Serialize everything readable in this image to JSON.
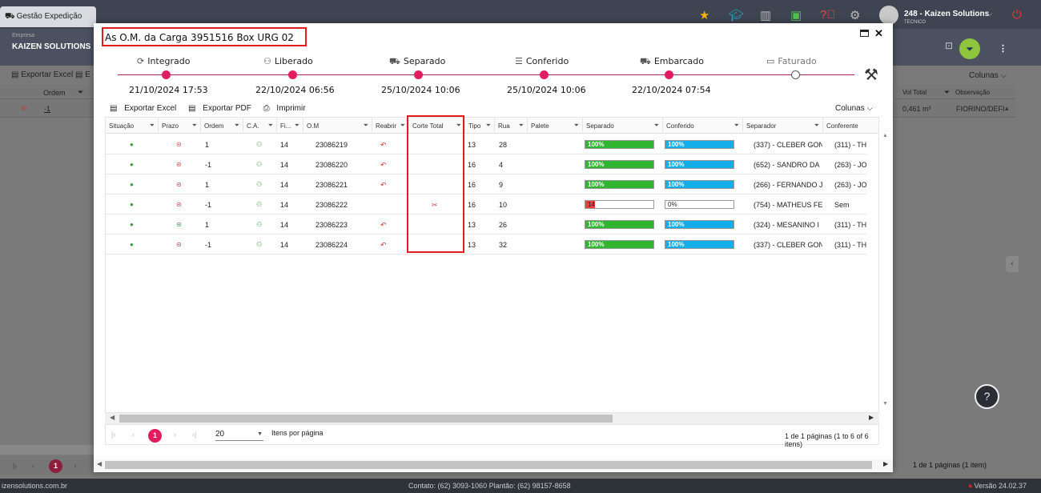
{
  "app": {
    "tab_label": "Gestão Expedição",
    "user_name": "248 - Kaizen Solutions",
    "user_role": "TECNICO",
    "empresa_label": "Empresa",
    "empresa": "KAIZEN SOLUTIONS",
    "toolbar_export_excel": "Exportar Excel",
    "toolbar_export_excel_trunc": "E",
    "colunas": "Colunas",
    "head_ordem": "Ordem",
    "head_vol_total": "Vol Total",
    "head_observacao": "Observação",
    "row_ordem": "-1",
    "row_vol": "0,461 m³",
    "row_obs": "FIORINO/DEFI",
    "page": "1",
    "pager_info": "1 de 1 páginas (1 item)",
    "help": "?"
  },
  "footer": {
    "site": "izensolutions.com.br",
    "contact": "Contato: (62) 3093-1060  Plantão: (62) 98157-8658",
    "version": "Versão 24.02.37"
  },
  "modal": {
    "title": "As O.M. da Carga 3951516 Box URG 02",
    "steps": [
      {
        "label": "Integrado",
        "icon": "sync-icon",
        "glyph": "⟳",
        "date": "21/10/2024 17:53",
        "done": true
      },
      {
        "label": "Liberado",
        "icon": "users-icon",
        "glyph": "⚇",
        "date": "22/10/2024 06:56",
        "done": true
      },
      {
        "label": "Separado",
        "icon": "forklift-icon",
        "glyph": "⛟",
        "date": "25/10/2024 10:06",
        "done": true
      },
      {
        "label": "Conferido",
        "icon": "list-check-icon",
        "glyph": "☰",
        "date": "25/10/2024 10:06",
        "done": true
      },
      {
        "label": "Embarcado",
        "icon": "truck-icon",
        "glyph": "⛟",
        "date": "22/10/2024 07:54",
        "done": true
      },
      {
        "label": "Faturado",
        "icon": "invoice-icon",
        "glyph": "▭",
        "date": "",
        "done": false
      }
    ],
    "toolbar": {
      "export_excel": "Exportar Excel",
      "export_pdf": "Exportar PDF",
      "print": "Imprimir",
      "colunas": "Colunas"
    },
    "columns": [
      "Situação",
      "Prazo",
      "Ordem",
      "C.A.",
      "Fi...",
      "O.M",
      "Reabrir",
      "Corte Total",
      "Tipo",
      "Rua",
      "Palete",
      "Separado",
      "Conferido",
      "Separador",
      "Conferente"
    ],
    "rows": [
      {
        "ordem": "1",
        "fi": "14",
        "om": "23086219",
        "reabrir": true,
        "corte": false,
        "tipo": "13",
        "rua": "28",
        "separado": 100,
        "separado_label": "100%",
        "conferido": 100,
        "conferido_label": "100%",
        "separador": "(337) - CLEBER GON",
        "conferente": "(311) - TH",
        "prazo_ok": false
      },
      {
        "ordem": "-1",
        "fi": "14",
        "om": "23086220",
        "reabrir": true,
        "corte": false,
        "tipo": "16",
        "rua": "4",
        "separado": 100,
        "separado_label": "100%",
        "conferido": 100,
        "conferido_label": "100%",
        "separador": "(652) - SANDRO DA",
        "conferente": "(263) - JO",
        "prazo_ok": false
      },
      {
        "ordem": "1",
        "fi": "14",
        "om": "23086221",
        "reabrir": true,
        "corte": false,
        "tipo": "16",
        "rua": "9",
        "separado": 100,
        "separado_label": "100%",
        "conferido": 100,
        "conferido_label": "100%",
        "separador": "(266) - FERNANDO J",
        "conferente": "(263) - JO",
        "prazo_ok": false
      },
      {
        "ordem": "-1",
        "fi": "14",
        "om": "23086222",
        "reabrir": false,
        "corte": true,
        "tipo": "16",
        "rua": "10",
        "separado": 14,
        "separado_label": "14",
        "conferido": 0,
        "conferido_label": "0%",
        "separador": "(754) - MATHEUS FE",
        "conferente": "Sem",
        "prazo_ok": false
      },
      {
        "ordem": "1",
        "fi": "14",
        "om": "23086223",
        "reabrir": true,
        "corte": false,
        "tipo": "13",
        "rua": "26",
        "separado": 100,
        "separado_label": "100%",
        "conferido": 100,
        "conferido_label": "100%",
        "separador": "(324) - MESANINO I",
        "conferente": "(311) - TH",
        "prazo_ok": true
      },
      {
        "ordem": "-1",
        "fi": "14",
        "om": "23086224",
        "reabrir": true,
        "corte": false,
        "tipo": "13",
        "rua": "32",
        "separado": 100,
        "separado_label": "100%",
        "conferido": 100,
        "conferido_label": "100%",
        "separador": "(337) - CLEBER GON",
        "conferente": "(311) - TH",
        "prazo_ok": false
      }
    ],
    "pager": {
      "current": "1",
      "page_size": "20",
      "page_size_label": "Itens por página",
      "info": "1 de 1 páginas (1 to 6 of 6 itens)"
    },
    "colors": {
      "accent": "#e31c5f",
      "green": "#2fb52f",
      "blue": "#13aee9",
      "red": "#e94040",
      "highlight": "#e31d1d"
    }
  }
}
